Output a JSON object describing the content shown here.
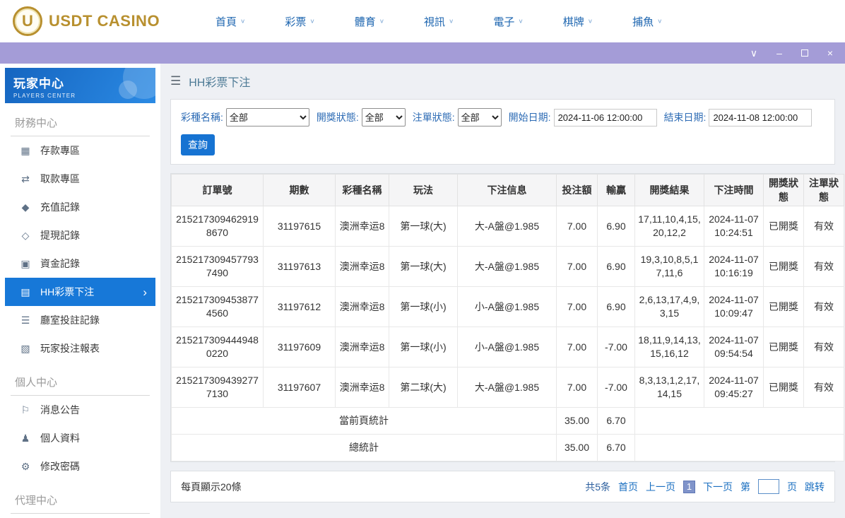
{
  "colors": {
    "accent_blue": "#1673d2",
    "titlebar_lavender": "#a49cd7",
    "brand_gold": "#b8902f",
    "link_blue": "#1a6fc0",
    "sidebar_header_blue": "#1a7ad9"
  },
  "icons": {
    "chevron_down": "∨",
    "chevron_right": "›",
    "minimize": "–",
    "close": "×",
    "menu": "☰"
  },
  "topbar": {
    "brand": "USDT CASINO",
    "logo_letter": "U",
    "nav_items": [
      {
        "name": "home",
        "label": "首頁"
      },
      {
        "name": "lottery",
        "label": "彩票"
      },
      {
        "name": "sports",
        "label": "體育"
      },
      {
        "name": "live-video",
        "label": "視訊"
      },
      {
        "name": "electronic",
        "label": "電子"
      },
      {
        "name": "board-games",
        "label": "棋牌"
      },
      {
        "name": "fishing",
        "label": "捕魚"
      }
    ]
  },
  "sidebar": {
    "title": "玩家中心",
    "subtitle": "PLAYERS CENTER",
    "sections": [
      {
        "name": "finance-center",
        "header": "財務中心",
        "items": [
          {
            "name": "deposit-zone",
            "icon": "deposit-icon",
            "glyph": "▦",
            "label": "存款專區",
            "active": false
          },
          {
            "name": "withdraw-zone",
            "icon": "withdraw-icon",
            "glyph": "⇄",
            "label": "取款專區",
            "active": false
          },
          {
            "name": "recharge-record",
            "icon": "recharge-record-icon",
            "glyph": "◆",
            "label": "充值記錄",
            "active": false
          },
          {
            "name": "withdrawal-record",
            "icon": "withdrawal-record-icon",
            "glyph": "◇",
            "label": "提現記錄",
            "active": false
          },
          {
            "name": "funds-record",
            "icon": "funds-record-icon",
            "glyph": "▣",
            "label": "資金記錄",
            "active": false
          },
          {
            "name": "hh-lottery-bet",
            "icon": "lottery-bet-icon",
            "glyph": "▤",
            "label": "HH彩票下注",
            "active": true
          },
          {
            "name": "room-bet-record",
            "icon": "room-bet-record-icon",
            "glyph": "☰",
            "label": "廳室投註記錄",
            "active": false
          },
          {
            "name": "player-bet-report",
            "icon": "player-bet-report-icon",
            "glyph": "▧",
            "label": "玩家投注報表",
            "active": false
          }
        ]
      },
      {
        "name": "personal-center",
        "header": "個人中心",
        "items": [
          {
            "name": "announcements",
            "icon": "announcement-bell-icon",
            "glyph": "⚐",
            "label": "消息公告",
            "active": false
          },
          {
            "name": "profile",
            "icon": "person-icon",
            "glyph": "♟",
            "label": "個人資料",
            "active": false
          },
          {
            "name": "change-password",
            "icon": "gear-icon",
            "glyph": "⚙",
            "label": "修改密碼",
            "active": false
          }
        ]
      },
      {
        "name": "agent-center",
        "header": "代理中心",
        "items": []
      }
    ]
  },
  "main": {
    "breadcrumb": "HH彩票下注",
    "filters": {
      "lottery_name_label": "彩種名稱:",
      "lottery_name_value": "全部",
      "draw_status_label": "開獎狀態:",
      "draw_status_value": "全部",
      "order_status_label": "注單狀態:",
      "order_status_value": "全部",
      "start_date_label": "開始日期:",
      "start_date_value": "2024-11-06 12:00:00",
      "end_date_label": "結束日期:",
      "end_date_value": "2024-11-08 12:00:00",
      "search_button": "查詢"
    },
    "table": {
      "headers": [
        "訂單號",
        "期數",
        "彩種名稱",
        "玩法",
        "下注信息",
        "投注額",
        "輸贏",
        "開獎結果",
        "下注時間",
        "開獎狀態",
        "注單狀態"
      ],
      "rows": [
        [
          "2152173094629198670",
          "31197615",
          "澳洲幸运8",
          "第一球(大)",
          "大-A盤@1.985",
          "7.00",
          "6.90",
          "17,11,10,4,15,20,12,2",
          "2024-11-07 10:24:51",
          "已開獎",
          "有效"
        ],
        [
          "2152173094577937490",
          "31197613",
          "澳洲幸运8",
          "第一球(大)",
          "大-A盤@1.985",
          "7.00",
          "6.90",
          "19,3,10,8,5,17,11,6",
          "2024-11-07 10:16:19",
          "已開獎",
          "有效"
        ],
        [
          "2152173094538774560",
          "31197612",
          "澳洲幸运8",
          "第一球(小)",
          "小-A盤@1.985",
          "7.00",
          "6.90",
          "2,6,13,17,4,9,3,15",
          "2024-11-07 10:09:47",
          "已開獎",
          "有效"
        ],
        [
          "2152173094449480220",
          "31197609",
          "澳洲幸运8",
          "第一球(小)",
          "小-A盤@1.985",
          "7.00",
          "-7.00",
          "18,11,9,14,13,15,16,12",
          "2024-11-07 09:54:54",
          "已開獎",
          "有效"
        ],
        [
          "2152173094392777130",
          "31197607",
          "澳洲幸运8",
          "第二球(大)",
          "大-A盤@1.985",
          "7.00",
          "-7.00",
          "8,3,13,1,2,17,14,15",
          "2024-11-07 09:45:27",
          "已開獎",
          "有效"
        ]
      ],
      "summary_rows": [
        {
          "name": "current-page-total",
          "label": "當前頁統計",
          "bet": "35.00",
          "winloss": "6.70"
        },
        {
          "name": "grand-total",
          "label": "總統計",
          "bet": "35.00",
          "winloss": "6.70"
        }
      ]
    },
    "pagination": {
      "page_size_text": "每頁顯示20條",
      "total_text": "共5条",
      "first": "首页",
      "prev": "上一页",
      "current_page": "1",
      "next": "下一页",
      "jump_prefix": "第",
      "jump_suffix": "页",
      "jump_button": "跳转"
    }
  }
}
